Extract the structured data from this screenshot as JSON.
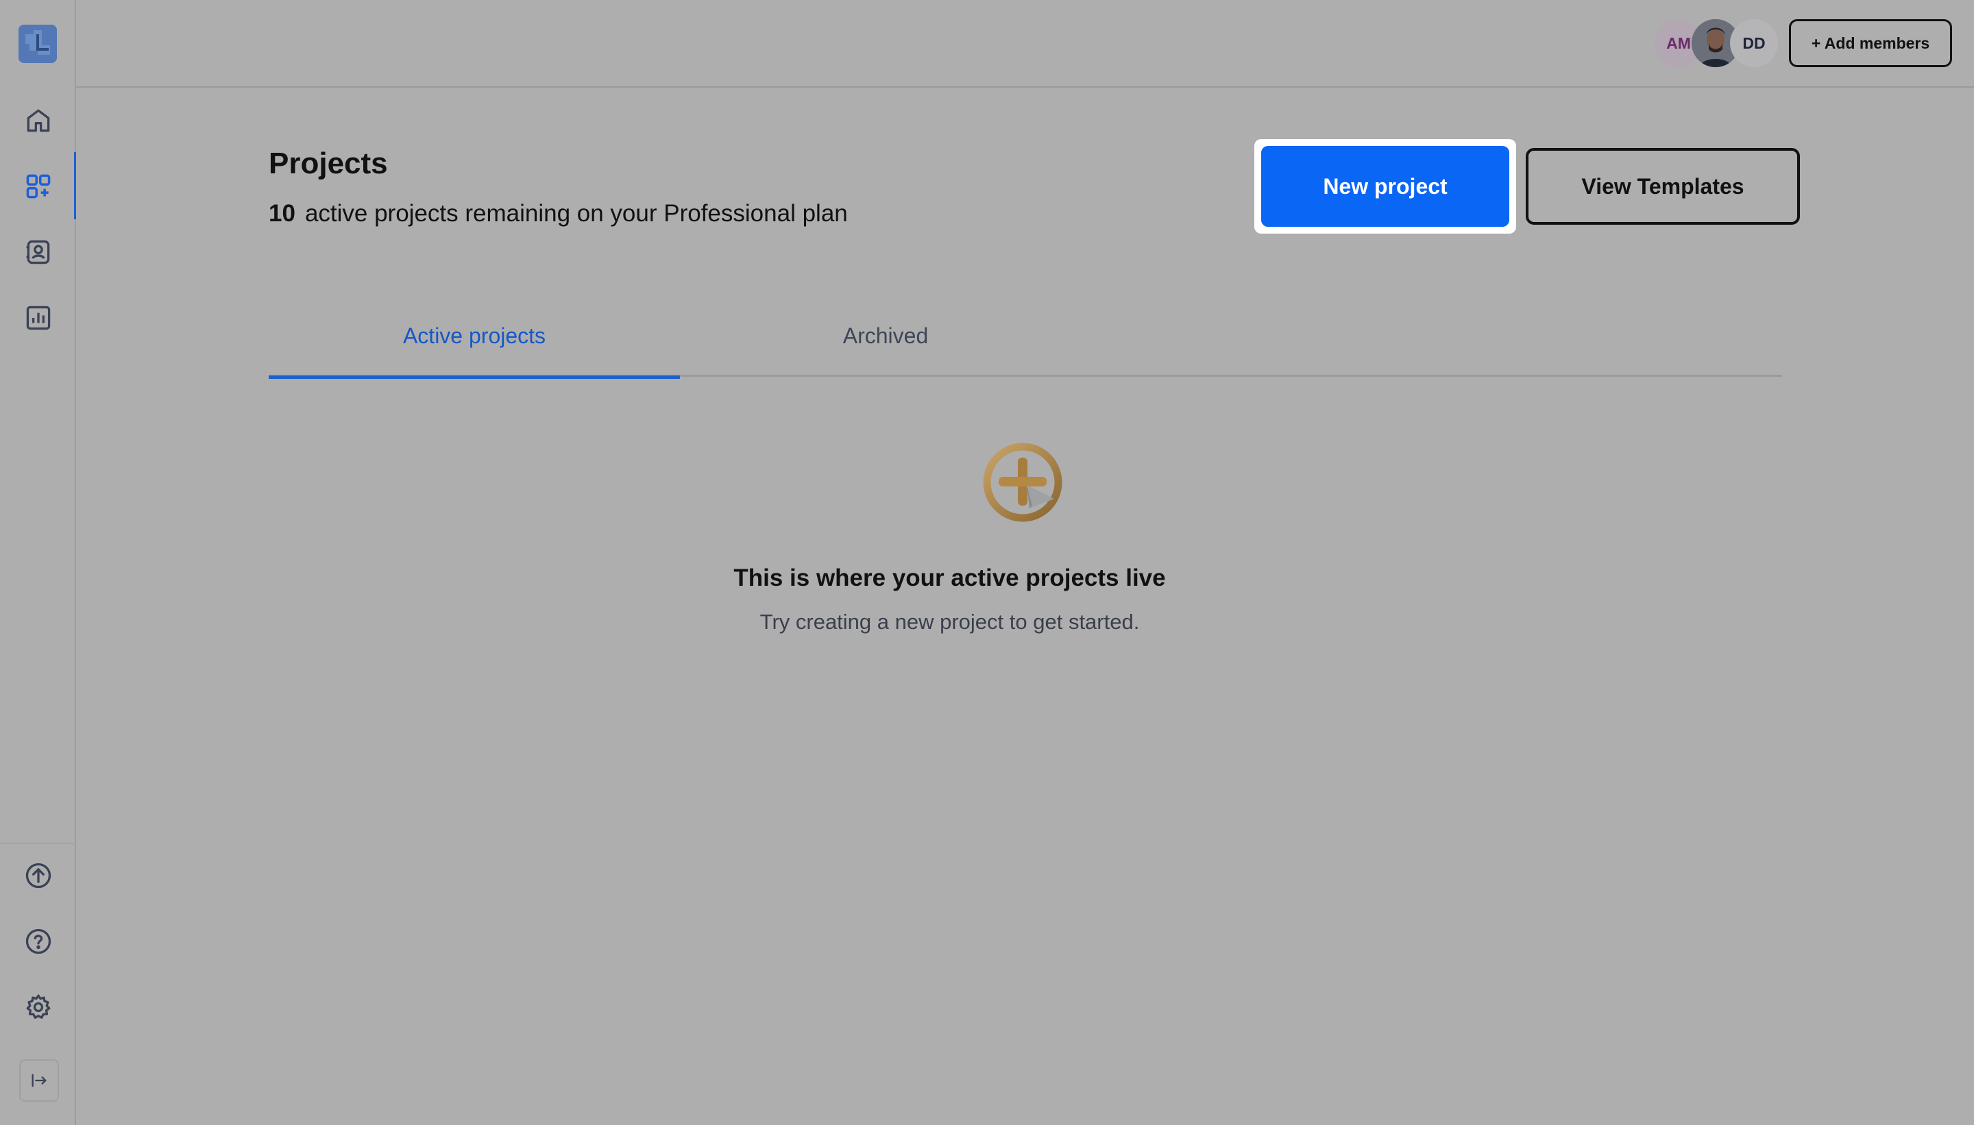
{
  "sidebar": {
    "logo": "app-logo",
    "items": [
      {
        "name": "home",
        "icon": "home-icon"
      },
      {
        "name": "projects",
        "icon": "grid-icon",
        "active": true
      },
      {
        "name": "contacts",
        "icon": "contacts-icon"
      },
      {
        "name": "analytics",
        "icon": "bar-chart-icon"
      }
    ],
    "bottom_items": [
      {
        "name": "upgrade",
        "icon": "upload-circle-icon"
      },
      {
        "name": "help",
        "icon": "help-icon"
      },
      {
        "name": "settings",
        "icon": "gear-icon"
      }
    ],
    "collapse_icon": "expand-sidebar-icon"
  },
  "header": {
    "avatars": [
      {
        "initials": "AM"
      },
      {
        "initials": "",
        "type": "photo"
      },
      {
        "initials": "DD"
      }
    ],
    "add_members_label": "+ Add members"
  },
  "main": {
    "title": "Projects",
    "remaining_count": "10",
    "remaining_text": "active projects remaining on your Professional plan",
    "new_project_label": "New project",
    "view_templates_label": "View Templates",
    "tabs": [
      {
        "label": "Active projects",
        "active": true
      },
      {
        "label": "Archived",
        "active": false
      }
    ],
    "empty_state": {
      "icon": "add-project-icon",
      "title": "This is where your active projects live",
      "subtitle": "Try creating a new project to get started."
    }
  },
  "colors": {
    "background": "#aeaeaf",
    "accent": "#0a66f5",
    "tab_active": "#1458c7"
  }
}
